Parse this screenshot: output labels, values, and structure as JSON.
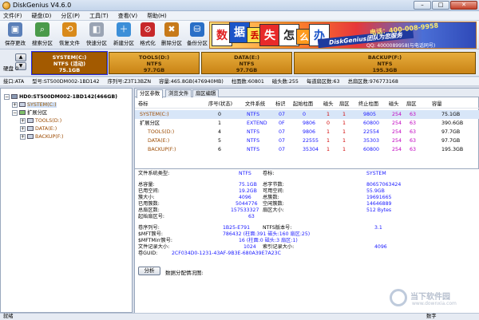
{
  "window": {
    "title": "DiskGenius V4.6.0",
    "min": "–",
    "max": "□",
    "close": "✕"
  },
  "menu": [
    "文件(F)",
    "硬盘(D)",
    "分区(P)",
    "工具(T)",
    "查看(V)",
    "帮助(H)"
  ],
  "toolbar": [
    {
      "label": "保存更改",
      "icon": "save-icon",
      "color": "#5a7fb8",
      "glyph": "▣"
    },
    {
      "label": "搜索分区",
      "icon": "search-icon",
      "color": "#4a9a4a",
      "glyph": "⌕"
    },
    {
      "label": "恢复文件",
      "icon": "recover-icon",
      "color": "#d98a1a",
      "glyph": "⟲"
    },
    {
      "label": "快速分区",
      "icon": "quick-partition-icon",
      "color": "#9aa4b4",
      "glyph": "◧"
    },
    {
      "label": "新建分区",
      "icon": "new-partition-icon",
      "color": "#3c8fd8",
      "glyph": "＋"
    },
    {
      "label": "格式化",
      "icon": "format-icon",
      "color": "#c7282a",
      "glyph": "⊘"
    },
    {
      "label": "删除分区",
      "icon": "delete-partition-icon",
      "color": "#c77a1a",
      "glyph": "✖"
    },
    {
      "label": "备份分区",
      "icon": "backup-icon",
      "color": "#2a6fc7",
      "glyph": "⛁"
    }
  ],
  "ad": {
    "chars": [
      "数",
      "据",
      "丢",
      "失",
      "怎",
      "么",
      "办"
    ],
    "slogan": "DiskGenius团队为您服务",
    "phone": "电话：400-008-9958",
    "qq": "QQ: 4000089958(与电话同号)"
  },
  "diskbar": {
    "label": "硬盘 0",
    "up": "▲",
    "down": "▼",
    "partitions": [
      {
        "name": "SYSTEM(C:)",
        "fs": "NTFS (活动)",
        "size": "75.1GB",
        "selected": true
      },
      {
        "name": "TOOLS(D:)",
        "fs": "NTFS",
        "size": "97.7GB",
        "selected": false
      },
      {
        "name": "DATA(E:)",
        "fs": "NTFS",
        "size": "97.7GB",
        "selected": false
      },
      {
        "name": "BACKUP(F:)",
        "fs": "NTFS",
        "size": "195.3GB",
        "selected": false
      }
    ]
  },
  "disk_info": [
    "接口:ATA",
    "型号:ST500DM002-1BD142",
    "序列号:Z3T13BZN",
    "容量:465.8GB(476940MB)",
    "柱面数:60801",
    "磁头数:255",
    "每道扇区数:63",
    "总扇区数:976773168"
  ],
  "tree": {
    "disk": "HD0:ST500DM002-1BD142(466GB)",
    "system": "SYSTEM(C:)",
    "extended": "扩展分区",
    "tools": "TOOLS(D:)",
    "data": "DATA(E:)",
    "backup": "BACKUP(F:)",
    "plus": "+",
    "minus": "−"
  },
  "tabs": [
    "分区参数",
    "浏览文件",
    "扇区编辑"
  ],
  "table": {
    "headers": [
      "卷标",
      "序号(状态)",
      "文件系统",
      "标识",
      "起始柱面",
      "磁头",
      "扇区",
      "终止柱面",
      "磁头",
      "扇区",
      "容量"
    ],
    "rows": [
      {
        "label": "SYSTEM(C:)",
        "seq": "0",
        "fs": "NTFS",
        "id": "07",
        "sc": "0",
        "sh": "1",
        "ss": "1",
        "ec": "9805",
        "eh": "254",
        "es": "63",
        "cap": "75.1GB",
        "indent": 1
      },
      {
        "label": "扩展分区",
        "seq": "1",
        "fs": "EXTEND",
        "id": "0F",
        "sc": "9806",
        "sh": "0",
        "ss": "1",
        "ec": "60800",
        "eh": "254",
        "es": "63",
        "cap": "390.6GB",
        "indent": 1
      },
      {
        "label": "TOOLS(D:)",
        "seq": "4",
        "fs": "NTFS",
        "id": "07",
        "sc": "9806",
        "sh": "1",
        "ss": "1",
        "ec": "22554",
        "eh": "254",
        "es": "63",
        "cap": "97.7GB",
        "indent": 2
      },
      {
        "label": "DATA(E:)",
        "seq": "5",
        "fs": "NTFS",
        "id": "07",
        "sc": "22555",
        "sh": "1",
        "ss": "1",
        "ec": "35303",
        "eh": "254",
        "es": "63",
        "cap": "97.7GB",
        "indent": 2
      },
      {
        "label": "BACKUP(F:)",
        "seq": "6",
        "fs": "NTFS",
        "id": "07",
        "sc": "35304",
        "sh": "1",
        "ss": "1",
        "ec": "60800",
        "eh": "254",
        "es": "63",
        "cap": "195.3GB",
        "indent": 2
      }
    ]
  },
  "details": {
    "fs_type_label": "文件系统类型:",
    "fs_type": "NTFS",
    "vol_label_label": "卷标:",
    "vol_label": "SYSTEM",
    "total_label": "总容量:",
    "total": "75.1GB",
    "total_bytes_label": "总字节数:",
    "total_bytes": "80657063424",
    "used_label": "已用空间:",
    "used": "19.2GB",
    "free_label": "可用空间:",
    "free": "55.9GB",
    "cluster_label": "簇大小:",
    "cluster": "4096",
    "clusters_label": "总簇数:",
    "clusters": "19691665",
    "used_clusters_label": "已用簇数:",
    "used_clusters": "5044776",
    "free_clusters_label": "空闲簇数:",
    "free_clusters": "14646889",
    "sectors_label": "总扇区数:",
    "sectors": "157533327",
    "sector_size_label": "扇区大小:",
    "sector_size": "512 Bytes",
    "start_sector_label": "起始扇区号:",
    "start_sector": "63",
    "serial_label": "卷序列号:",
    "serial": "1B25-E791",
    "version_label": "NTFS版本号:",
    "version": "3.1",
    "mft_label": "$MFT簇号:",
    "mft": "786432 (柱面:391 磁头:160 扇区:25)",
    "mftmirr_label": "$MFTMirr簇号:",
    "mftmirr": "16 (柱面:0 磁头:3 扇区:1)",
    "frs_label": "文件记录大小:",
    "frs": "1024",
    "irs_label": "索引记录大小:",
    "irs": "4096",
    "guid_label": "卷GUID:",
    "guid": "2CF034D0-1231-43AF-9B3E-680A39E7A23C",
    "analyze": "分析",
    "alloc_label": "数据分配情况图:"
  },
  "status": {
    "left": "就绪",
    "right": "数字"
  },
  "watermark": {
    "title": "当下软件园",
    "sub": "www.downxia.com"
  }
}
